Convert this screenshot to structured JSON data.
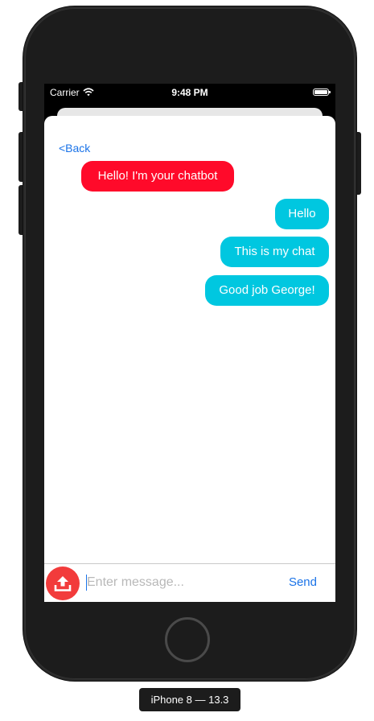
{
  "status_bar": {
    "carrier": "Carrier",
    "time": "9:48 PM",
    "icons": [
      "wifi-icon",
      "battery-icon"
    ]
  },
  "nav": {
    "back_label": "<Back"
  },
  "messages": [
    {
      "sender": "bot",
      "text": "Hello! I'm your chatbot",
      "color": "#ff0a2a"
    },
    {
      "sender": "user",
      "text": "Hello",
      "color": "#00c7e0"
    },
    {
      "sender": "user",
      "text": "This is my chat",
      "color": "#00c7e0"
    },
    {
      "sender": "user",
      "text": "Good job George!",
      "color": "#00c7e0"
    }
  ],
  "composer": {
    "upload_icon": "upload-icon",
    "upload_color": "#f23b3b",
    "placeholder": "Enter message...",
    "value": "",
    "send_label": "Send"
  },
  "device": {
    "label": "iPhone 8 — 13.3"
  },
  "colors": {
    "accent": "#1a73e8"
  }
}
